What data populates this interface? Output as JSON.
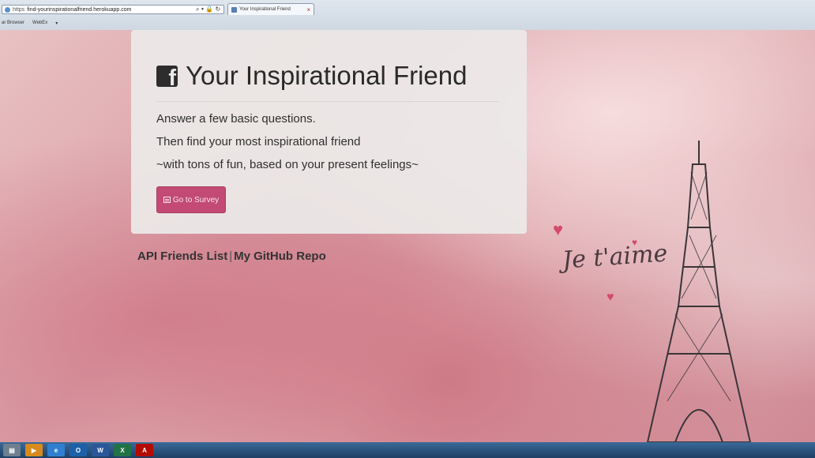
{
  "browser": {
    "address_scheme": "https",
    "address_url": "find-yourinspirationalfriend.herokuapp.com",
    "tab_title": "Your Inspirational Friend",
    "menu_items": [
      "ar Browser",
      "WebEx"
    ]
  },
  "jumbotron": {
    "title": "Your Inspirational Friend",
    "lines": [
      "Answer a few basic questions.",
      "Then find your most inspirational friend",
      "~with tons of fun, based on your present feelings~"
    ],
    "button_label": "Go to Survey"
  },
  "footer": {
    "links": [
      "API Friends List",
      "My GitHub Repo"
    ],
    "separator": "|"
  },
  "background": {
    "script_text": "Je t'aime"
  },
  "taskbar": {
    "items": [
      "explorer",
      "media-player",
      "internet-explorer",
      "outlook",
      "word",
      "excel",
      "acrobat"
    ]
  },
  "colors": {
    "button": "#c24a74",
    "jumbotron": "#ecebe9",
    "background": "#d9a3a8"
  }
}
